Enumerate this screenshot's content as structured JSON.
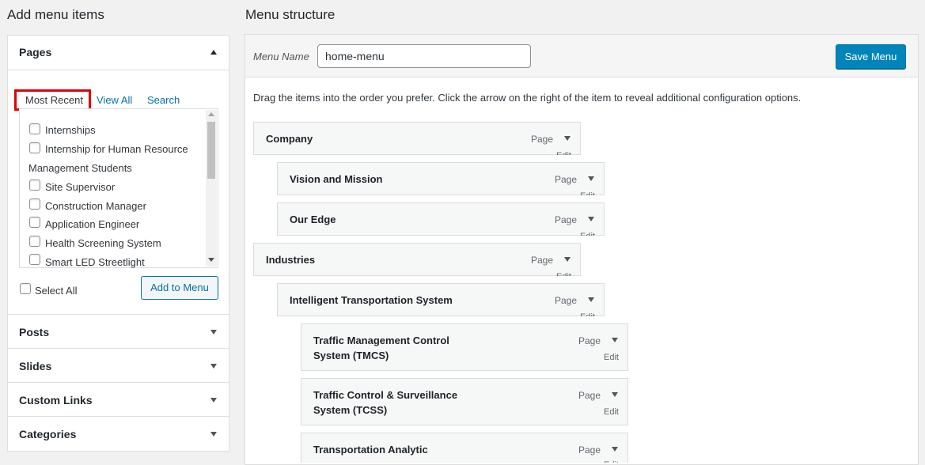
{
  "left": {
    "heading": "Add menu items",
    "pages": {
      "title": "Pages",
      "tabs": [
        "Most Recent",
        "View All",
        "Search"
      ],
      "items": [
        "Internships",
        "Internship for Human Resource",
        "Management Students",
        "Site Supervisor",
        "Construction Manager",
        "Application Engineer",
        "Health Screening System",
        "Smart LED Streetlight"
      ],
      "select_all": "Select All",
      "add_button": "Add to Menu"
    },
    "sections": [
      "Posts",
      "Slides",
      "Custom Links",
      "Categories"
    ]
  },
  "right": {
    "heading": "Menu structure",
    "menu_name_label": "Menu Name",
    "menu_name_value": "home-menu",
    "save_button": "Save Menu",
    "instructions": "Drag the items into the order you prefer. Click the arrow on the right of the item to reveal additional configuration options.",
    "items": [
      {
        "title": "Company",
        "type": "Page",
        "edit": "Edit"
      },
      {
        "title": "Vision and Mission",
        "type": "Page",
        "edit": "Edit"
      },
      {
        "title": "Our Edge",
        "type": "Page",
        "edit": "Edit"
      },
      {
        "title": "Industries",
        "type": "Page",
        "edit": "Edit"
      },
      {
        "title": "Intelligent Transportation System",
        "type": "Page",
        "edit": "Edit"
      },
      {
        "title_line1": "Traffic Management Control",
        "title_line2": "System (TMCS)",
        "type": "Page",
        "edit": "Edit"
      },
      {
        "title_line1": "Traffic Control & Surveillance",
        "title_line2": "System (TCSS)",
        "type": "Page",
        "edit": "Edit"
      },
      {
        "title": "Transportation Analytic",
        "type": "Page",
        "edit": "Edit"
      }
    ]
  },
  "colors": {
    "accent": "#0073aa",
    "highlight_box": "#e0000a"
  }
}
